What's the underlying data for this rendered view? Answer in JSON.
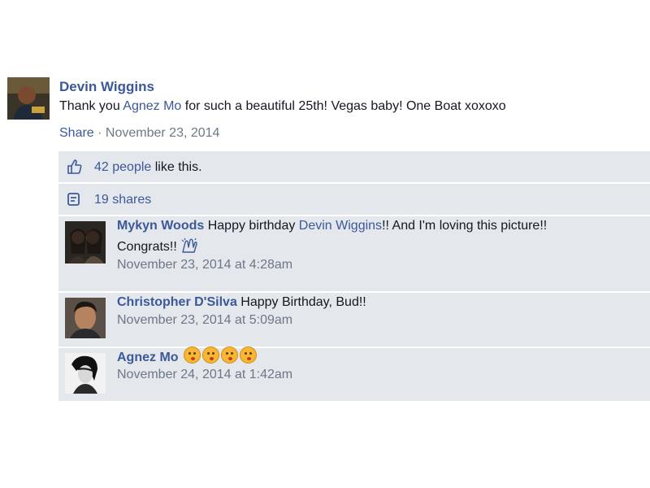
{
  "post": {
    "author": "Devin Wiggins",
    "text_prefix": "Thank you ",
    "tagged_name": "Agnez Mo",
    "text_suffix": " for such a beautiful 25th! Vegas baby! One Boat xoxoxo",
    "share_label": "Share",
    "separator": " · ",
    "date": "November 23, 2014"
  },
  "likes": {
    "icon": "thumbs-up-icon",
    "count_label": "42 people",
    "suffix": " like this."
  },
  "shares": {
    "icon": "share-icon",
    "label": "19 shares"
  },
  "comments": [
    {
      "author": "Mykyn Woods",
      "text_prefix": " Happy birthday ",
      "tagged_name": "Devin Wiggins",
      "text_suffix": "!! And I'm loving this picture!!",
      "text_line2": "Congrats!!",
      "timestamp": "November 23, 2014 at 4:28am"
    },
    {
      "author": "Christopher D'Silva",
      "text": " Happy Birthday, Bud!!",
      "timestamp": "November 23, 2014 at 5:09am"
    },
    {
      "author": "Agnez Mo",
      "emoji_icon": "kissing-face-emoji",
      "emoji_count": 4,
      "timestamp": "November 24, 2014 at 1:42am"
    }
  ],
  "colors": {
    "link": "#3b5998",
    "meta": "#6d7787",
    "ufi_background": "#e9ebee"
  }
}
